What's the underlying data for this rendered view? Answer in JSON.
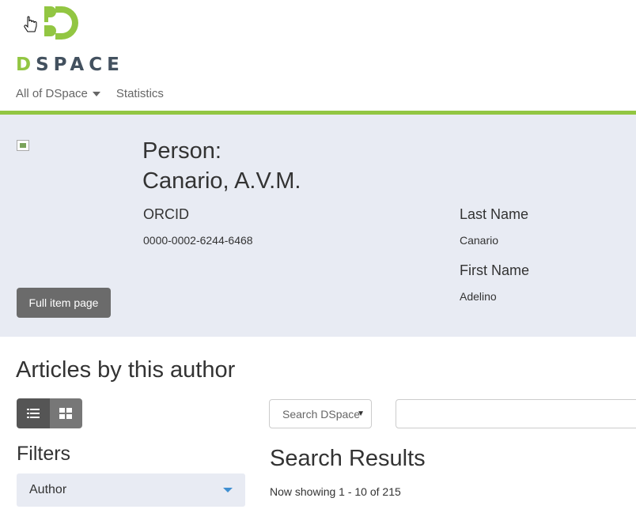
{
  "header": {
    "logo_text_accent": "D",
    "logo_text_rest": "SPACE",
    "nav": [
      {
        "label": "All of DSpace",
        "has_caret": true
      },
      {
        "label": "Statistics"
      }
    ]
  },
  "person": {
    "title_line1": "Person:",
    "title_line2": "Canario, A.V.M.",
    "orcid_label": "ORCID",
    "orcid_value": "0000-0002-6244-6468",
    "last_name_label": "Last Name",
    "last_name_value": "Canario",
    "first_name_label": "First Name",
    "first_name_value": "Adelino",
    "full_item_button": "Full item page"
  },
  "articles": {
    "title": "Articles by this author",
    "filters_title": "Filters",
    "filter_author": "Author",
    "scope_selected": "Search DSpace",
    "query_value": "",
    "results_title": "Search Results",
    "results_count": "Now showing 1 - 10 of 215"
  },
  "colors": {
    "brand_green": "#92c642",
    "banner_bg": "#e8ebf3"
  },
  "icons": [
    "dspace-logo-icon",
    "cursor-icon",
    "caret-down-icon",
    "image-placeholder-icon",
    "list-view-icon",
    "grid-view-icon",
    "filter-caret-icon",
    "select-arrow-icon"
  ]
}
